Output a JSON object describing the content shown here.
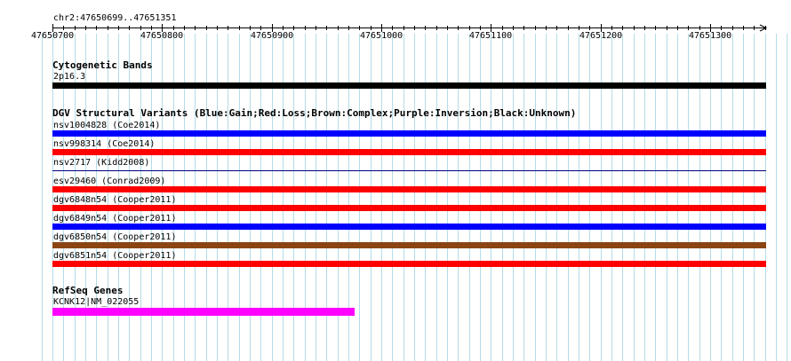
{
  "ruler": {
    "region": "chr2:47650699..47651351",
    "ticks": [
      "47650700",
      "47650800",
      "47650900",
      "47651000",
      "47651100",
      "47651200",
      "47651300"
    ]
  },
  "tracks": {
    "cytoband": {
      "title": "Cytogenetic Bands",
      "band_label": "2p16.3",
      "band_color": "#000000"
    },
    "dgv": {
      "title": "DGV Structural Variants (Blue:Gain;Red:Loss;Brown:Complex;Purple:Inversion;Black:Unknown)",
      "features": [
        {
          "label": "nsv1004828 (Coe2014)",
          "color": "#0000ff",
          "style": "thick"
        },
        {
          "label": "nsv998314 (Coe2014)",
          "color": "#ff0000",
          "style": "thick"
        },
        {
          "label": "nsv2717 (Kidd2008)",
          "color": "#000080",
          "style": "thin"
        },
        {
          "label": "esv29460 (Conrad2009)",
          "color": "#ff0000",
          "style": "thick"
        },
        {
          "label": "dgv6848n54 (Cooper2011)",
          "color": "#ff0000",
          "style": "thick"
        },
        {
          "label": "dgv6849n54 (Cooper2011)",
          "color": "#0000ff",
          "style": "thick"
        },
        {
          "label": "dgv6850n54 (Cooper2011)",
          "color": "#8b4513",
          "style": "thick"
        },
        {
          "label": "dgv6851n54 (Cooper2011)",
          "color": "#ff0000",
          "style": "thick"
        }
      ]
    },
    "refseq": {
      "title": "RefSeq Genes",
      "gene_label": "KCNK12|NM_022055",
      "gene_color": "#ff00ff"
    }
  },
  "colors": {
    "grid_line": "#b4dce8",
    "ruler": "#000000"
  }
}
